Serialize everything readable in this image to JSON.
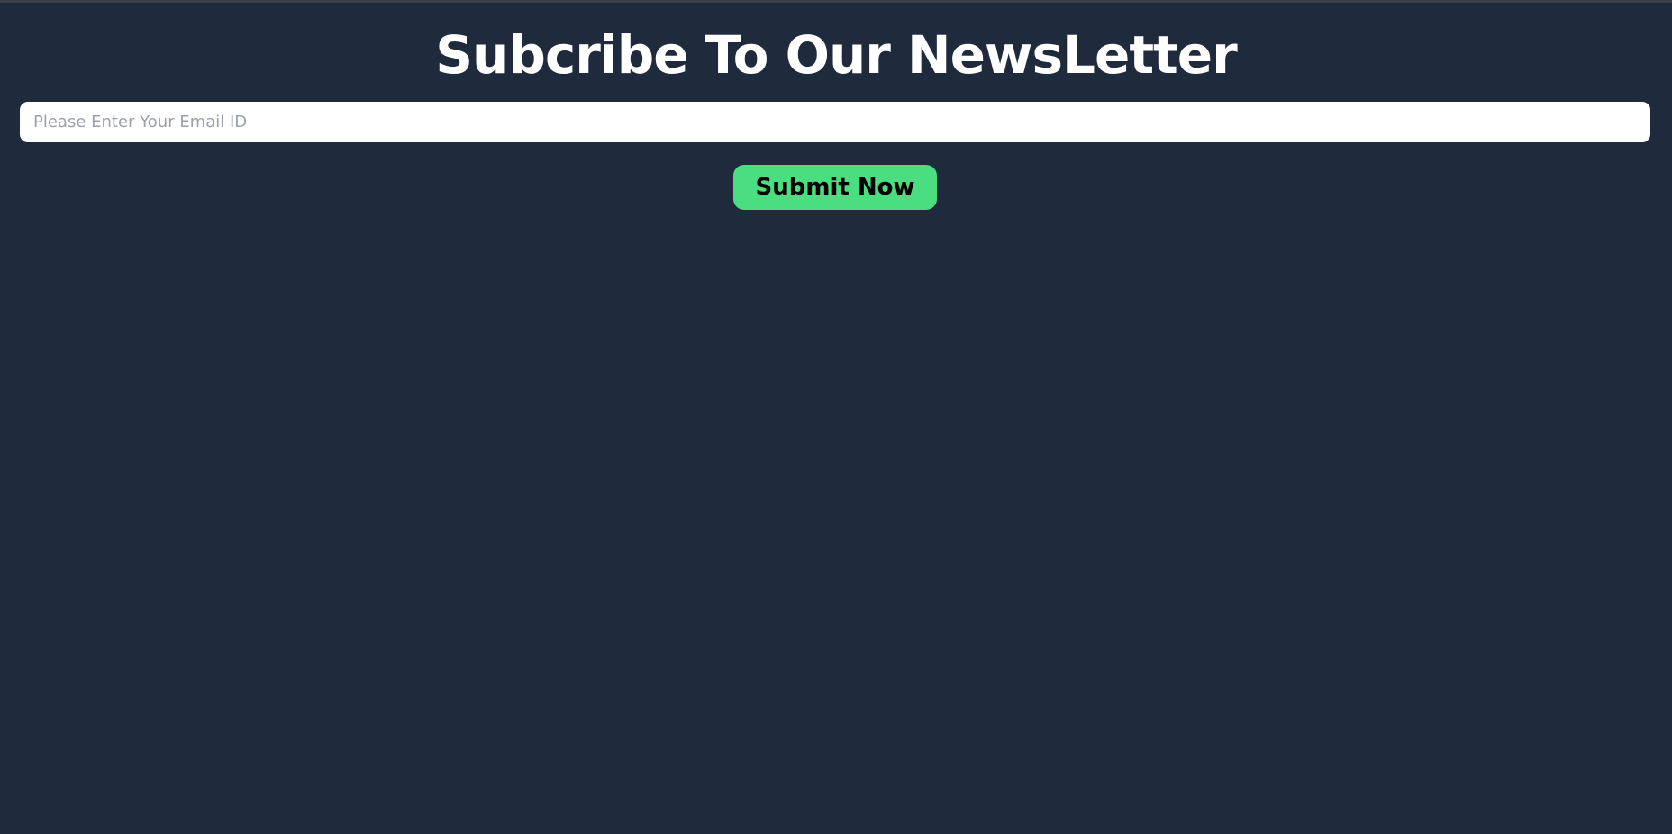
{
  "newsletter": {
    "title": "Subcribe To Our NewsLetter",
    "email_placeholder": "Please Enter Your Email ID",
    "email_value": "",
    "submit_label": "Submit Now"
  },
  "colors": {
    "background": "#1f2a3c",
    "title_text": "#ffffff",
    "input_background": "#ffffff",
    "placeholder_text": "#9aa1ab",
    "button_background": "#4ade80",
    "button_text": "#000000"
  }
}
